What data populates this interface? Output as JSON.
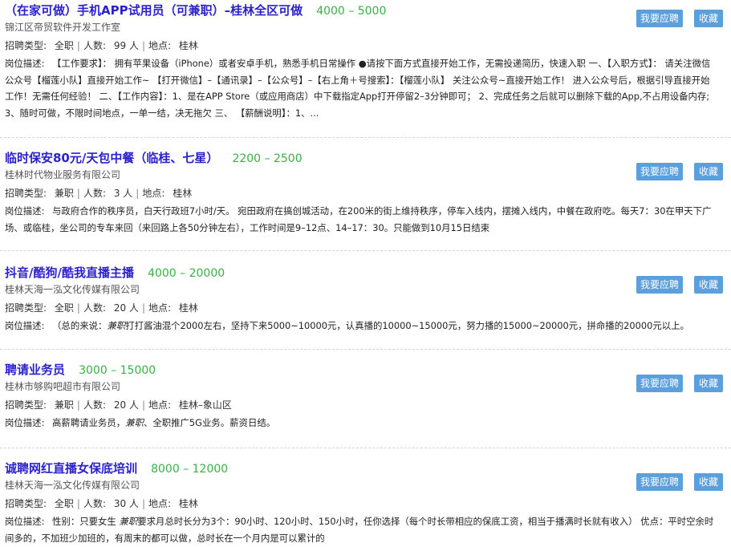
{
  "labels": {
    "type": "招聘类型:",
    "count": "人数:",
    "location": "地点:",
    "desc": "岗位描述:",
    "person_unit": "人",
    "apply": "我要应聘",
    "favorite": "收藏"
  },
  "jobs": [
    {
      "title": "（在家可做）手机APP试用员（可兼职）–桂林全区可做",
      "salary": "4000 – 5000",
      "company": "锦江区帝贸软件开发工作室",
      "type": "全职",
      "count": "99",
      "location": "桂林",
      "desc": "【工作要求】： 拥有苹果设备（iPhone）或者安卓手机，熟悉手机日常操作 ●请按下面方式直接开始工作，无需投递简历，快速入职 一、【入职方式】： 请关注微信公众号【榴莲小队】直接开始工作~ 【打开微信】–【通讯录】–【公众号】–【右上角＋号搜索】：【榴莲小队】 关注公众号~直接开始工作！ 进入公众号后，根据引导直接开始工作！无需任何经验！ 二、【工作内容】：1、是在APP Store（或应用商店）中下载指定App打开停留2–3分钟即可； 2、完成任务之后就可以删除下载的App,不占用设备内存; 3、随时可做，不限时间地点，一单一结，决无拖欠 三、 【薪酬说明】：1、..."
    },
    {
      "title": "临时保安80元/天包中餐（临桂、七星）",
      "salary": "2200 – 2500",
      "company": "桂林时代物业服务有限公司",
      "type": "兼职",
      "count": "3",
      "location": "桂林",
      "desc": "与政府合作的秩序员，白天行政班7小时/天。 宛田政府在搞创城活动，在200米的街上维持秩序，停车入线内，摆摊入线内，中餐在政府吃。每天7：30在甲天下广场、或临桂，坐公司的专车来回（来回路上各50分钟左右），工作时间是9–12点、14–17：30。只能做到10月15日结束"
    },
    {
      "title": "抖音/酷狗/酷我直播主播",
      "salary": "4000 – 20000",
      "company": "桂林天海一泓文化传媒有限公司",
      "type": "全职",
      "count": "20",
      "location": "桂林",
      "desc_pre": "（总的来说：",
      "desc_em": "兼职",
      "desc_post": "打打酱油混个2000左右，坚持下来5000~10000元，认真播的10000~15000元，努力播的15000~20000元，拼命播的20000元以上。"
    },
    {
      "title": "聘请业务员",
      "salary": "3000 – 15000",
      "company": "桂林市够购吧超市有限公司",
      "type": "兼职",
      "count": "20",
      "location": "桂林–象山区",
      "desc_pre": "高薪聘请业务员，",
      "desc_em": "兼职",
      "desc_post": "、全职推广5G业务。薪资日结。"
    },
    {
      "title": "诚聘网红直播女保底培训",
      "salary": "8000 – 12000",
      "company": "桂林天海一泓文化传媒有限公司",
      "type": "全职",
      "count": "30",
      "location": "桂林",
      "desc_pre": "性别：只要女生 ",
      "desc_em": "兼职",
      "desc_post": "要求月总时长分为3个：90小时、120小时、150小时，任你选择（每个时长带相应的保底工资，相当于播满时长就有收入） 优点：平时空余时间多的，不加班少加班的，有周末的都可以做，总时长在一个月内是可以累计的"
    }
  ]
}
